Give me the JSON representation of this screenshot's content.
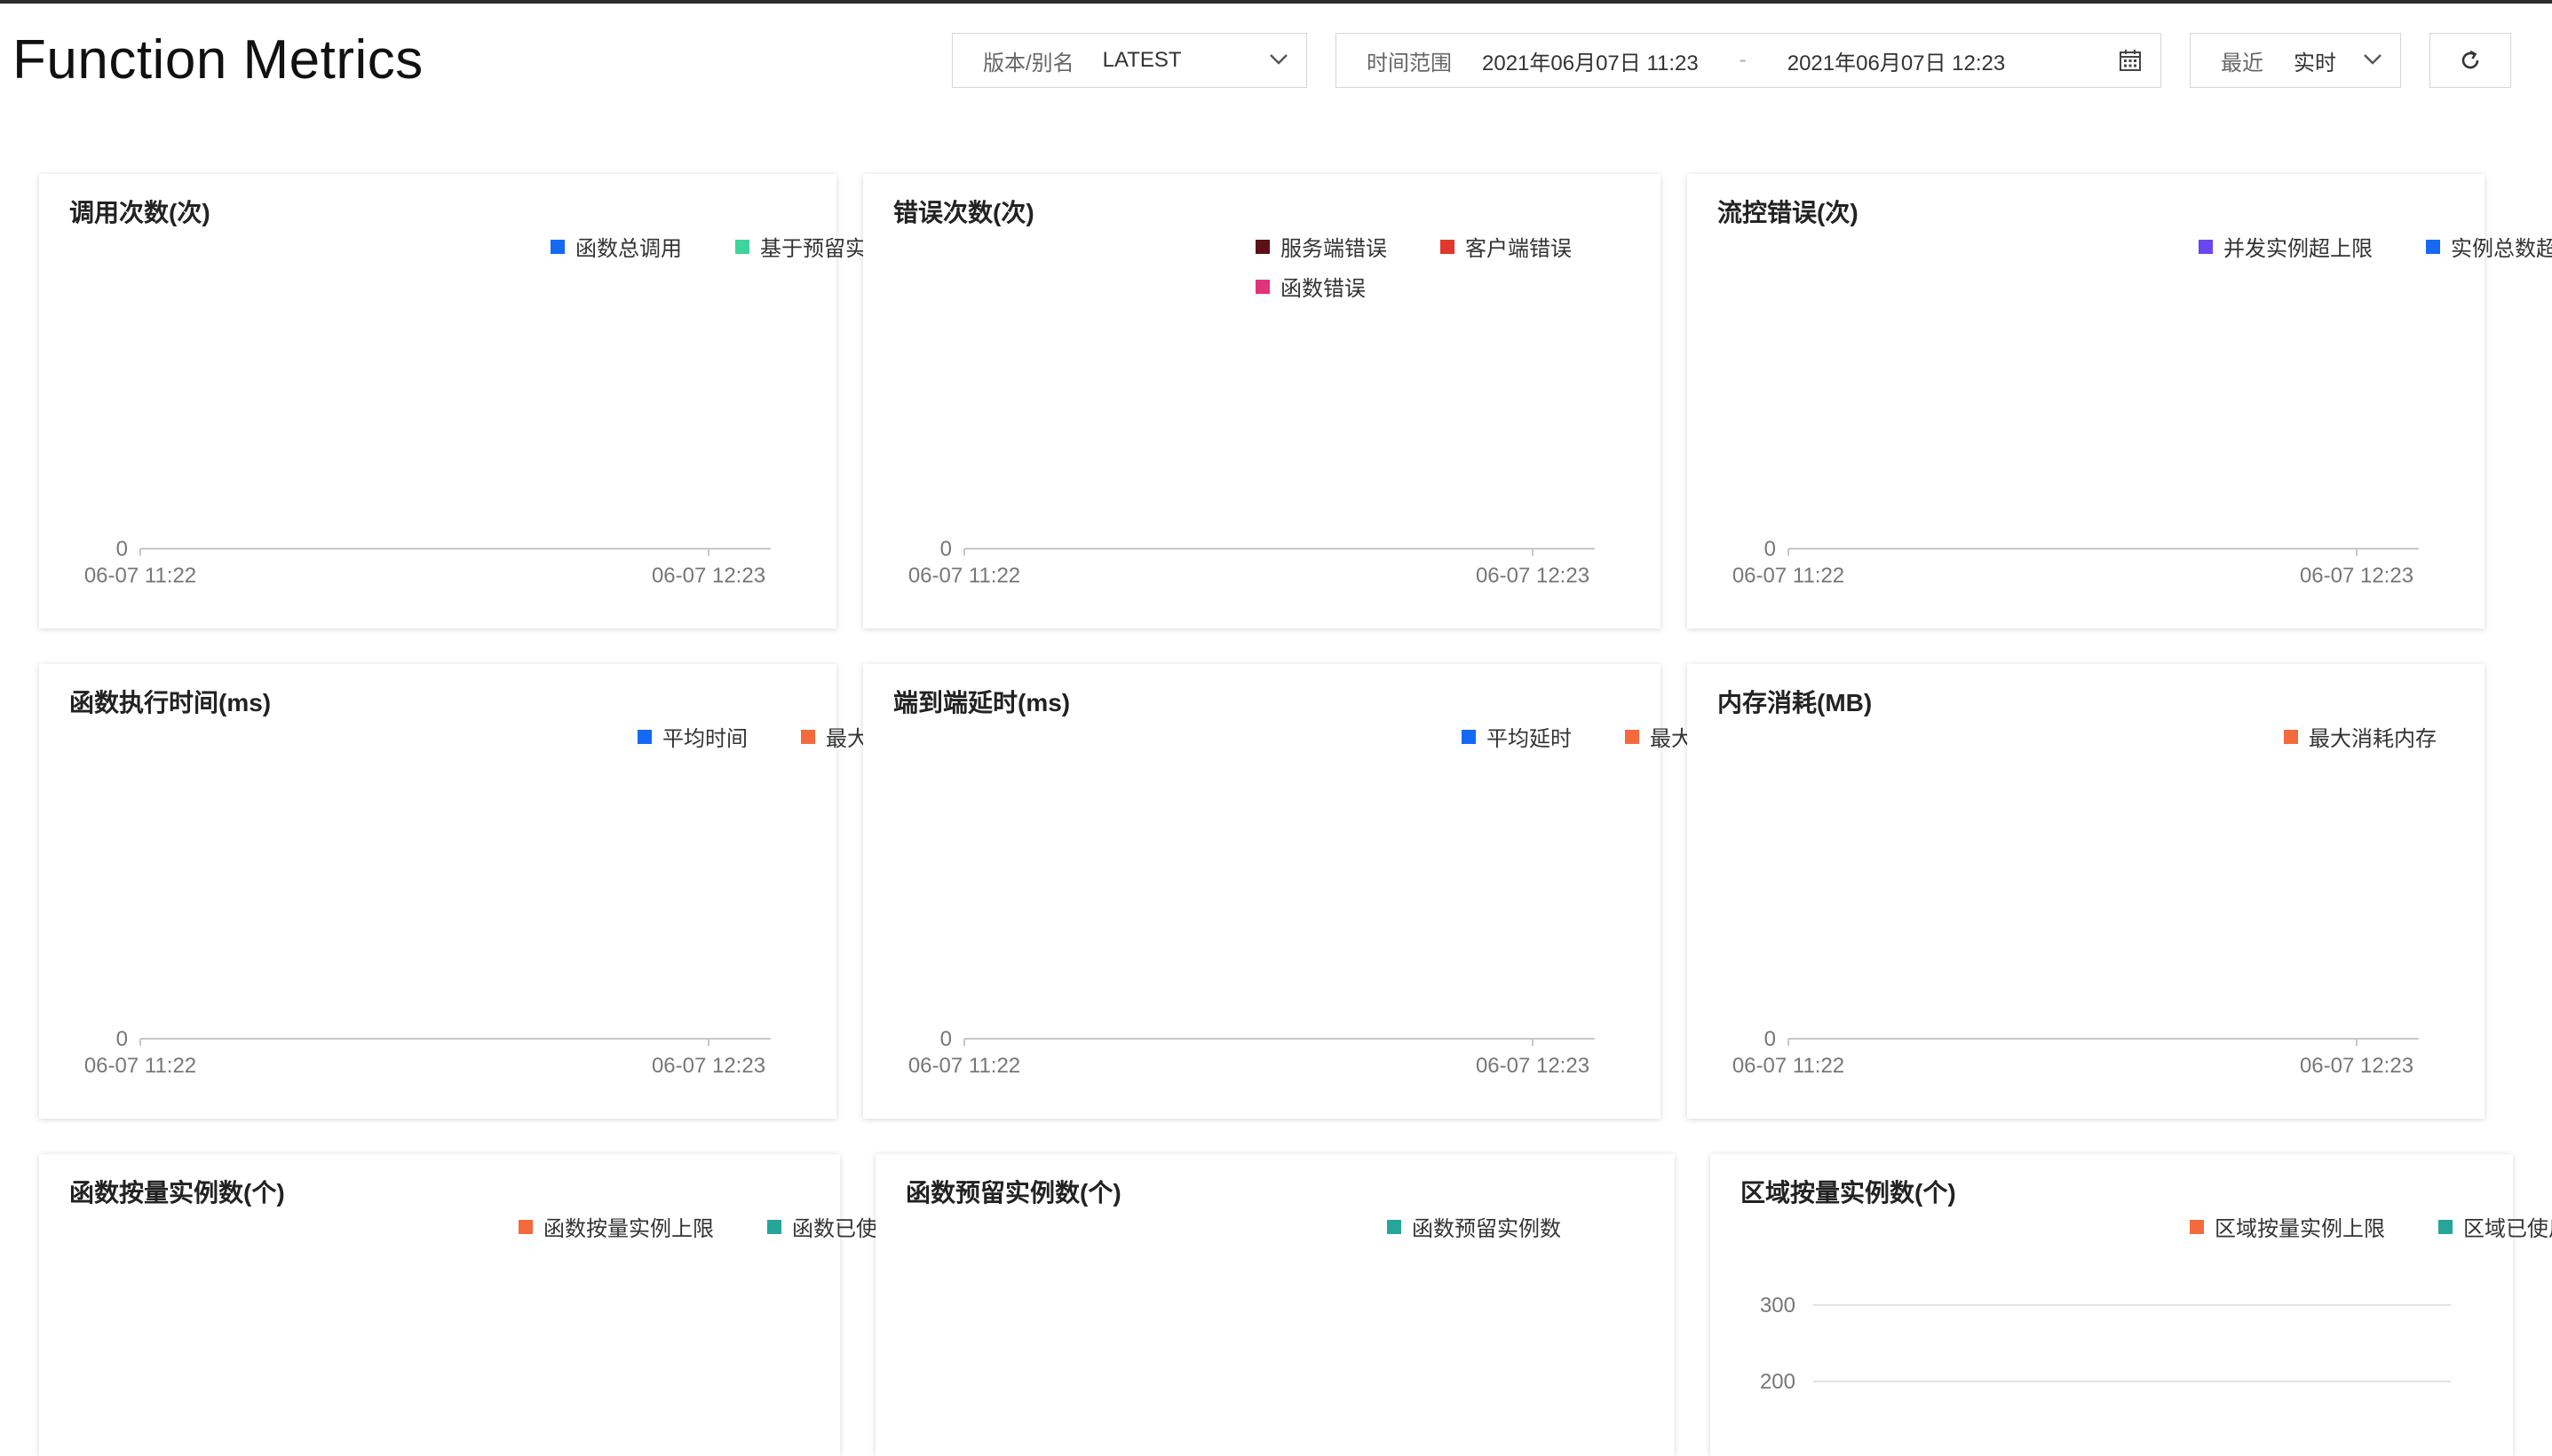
{
  "page": {
    "title": "Function Metrics"
  },
  "toolbar": {
    "version": {
      "label": "版本/别名",
      "value": "LATEST",
      "icon": "chevron-down-icon"
    },
    "time_range": {
      "label": "时间范围",
      "start": "2021年06月07日 11:23",
      "separator": "-",
      "end": "2021年06月07日 12:23",
      "icon": "calendar-icon"
    },
    "recent": {
      "label": "最近",
      "value": "实时",
      "icon": "chevron-down-icon"
    },
    "refresh": {
      "icon": "refresh-icon"
    }
  },
  "cards": [
    {
      "title": "调用次数(次)",
      "legend": [
        {
          "label": "函数总调用",
          "color": "#1469f5"
        },
        {
          "label": "基于预留实例的调用",
          "color": "#3fd49b"
        }
      ],
      "chart_data": {
        "type": "line",
        "x": [
          "06-07 11:22",
          "06-07 12:23"
        ],
        "yticks": [
          "0"
        ],
        "series": []
      }
    },
    {
      "title": "错误次数(次)",
      "legend": [
        {
          "label": "服务端错误",
          "color": "#5c1018"
        },
        {
          "label": "客户端错误",
          "color": "#e0382d"
        },
        {
          "label": "函数错误",
          "color": "#e0337c"
        }
      ],
      "chart_data": {
        "type": "line",
        "x": [
          "06-07 11:22",
          "06-07 12:23"
        ],
        "yticks": [
          "0"
        ],
        "series": []
      }
    },
    {
      "title": "流控错误(次)",
      "legend": [
        {
          "label": "并发实例超上限",
          "color": "#6b46ee"
        },
        {
          "label": "实例总数超上限",
          "color": "#1469f5"
        }
      ],
      "chart_data": {
        "type": "line",
        "x": [
          "06-07 11:22",
          "06-07 12:23"
        ],
        "yticks": [
          "0"
        ],
        "series": []
      }
    },
    {
      "title": "函数执行时间(ms)",
      "legend": [
        {
          "label": "平均时间",
          "color": "#1469f5"
        },
        {
          "label": "最大时间",
          "color": "#f46a3d"
        }
      ],
      "chart_data": {
        "type": "line",
        "x": [
          "06-07 11:22",
          "06-07 12:23"
        ],
        "yticks": [
          "0"
        ],
        "series": []
      }
    },
    {
      "title": "端到端延时(ms)",
      "legend": [
        {
          "label": "平均延时",
          "color": "#1469f5"
        },
        {
          "label": "最大延时",
          "color": "#f46a3d"
        }
      ],
      "chart_data": {
        "type": "line",
        "x": [
          "06-07 11:22",
          "06-07 12:23"
        ],
        "yticks": [
          "0"
        ],
        "series": []
      }
    },
    {
      "title": "内存消耗(MB)",
      "legend": [
        {
          "label": "最大消耗内存",
          "color": "#f46a3d"
        }
      ],
      "chart_data": {
        "type": "line",
        "x": [
          "06-07 11:22",
          "06-07 12:23"
        ],
        "yticks": [
          "0"
        ],
        "series": []
      }
    },
    {
      "title": "函数按量实例数(个)",
      "legend": [
        {
          "label": "函数按量实例上限",
          "color": "#f46a3d"
        },
        {
          "label": "函数已使用按量实例数",
          "color": "#26a69a"
        }
      ],
      "chart_data": {
        "type": "line",
        "x": [],
        "yticks": [],
        "series": []
      }
    },
    {
      "title": "函数预留实例数(个)",
      "legend": [
        {
          "label": "函数预留实例数",
          "color": "#26a69a"
        }
      ],
      "chart_data": {
        "type": "line",
        "x": [],
        "yticks": [],
        "series": []
      }
    },
    {
      "title": "区域按量实例数(个)",
      "legend": [
        {
          "label": "区域按量实例上限",
          "color": "#f46a3d"
        },
        {
          "label": "区域已使用按量实例数",
          "color": "#26a69a"
        }
      ],
      "chart_data": {
        "type": "line",
        "x": [],
        "yticks": [
          "300",
          "200"
        ],
        "series": []
      }
    }
  ]
}
